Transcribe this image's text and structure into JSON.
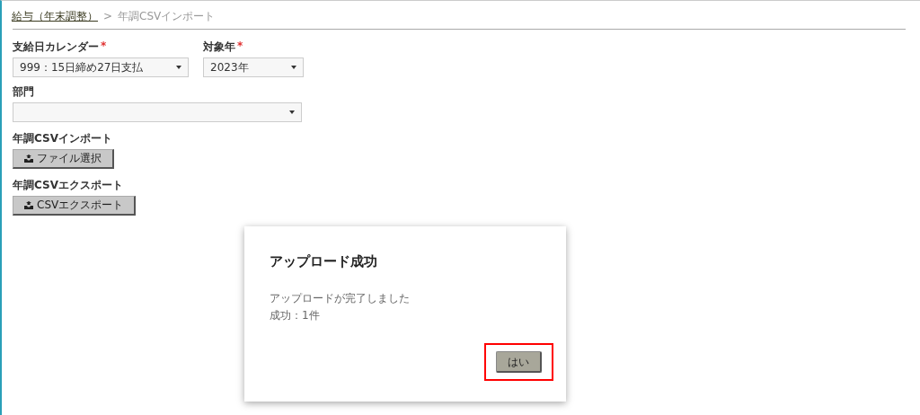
{
  "breadcrumb": {
    "link": "給与（年末調整）",
    "separator": ">",
    "current": "年調CSVインポート"
  },
  "fields": [
    {
      "label": "支給日カレンダー",
      "required": true,
      "value": "999：15日締め27日支払"
    },
    {
      "label": "対象年",
      "required": true,
      "value": "2023年"
    }
  ],
  "department": {
    "label": "部門",
    "required": false
  },
  "import_section": {
    "label": "年調CSVインポート",
    "button": "ファイル選択"
  },
  "export_section": {
    "label": "年調CSVエクスポート",
    "button": "CSVエクスポート"
  },
  "dialog": {
    "title": "アップロード成功",
    "lines": [
      "アップロードが完了しました",
      "成功：1件"
    ],
    "button": {
      "label": "はい",
      "highlighted": true
    }
  },
  "required_mark": "*"
}
